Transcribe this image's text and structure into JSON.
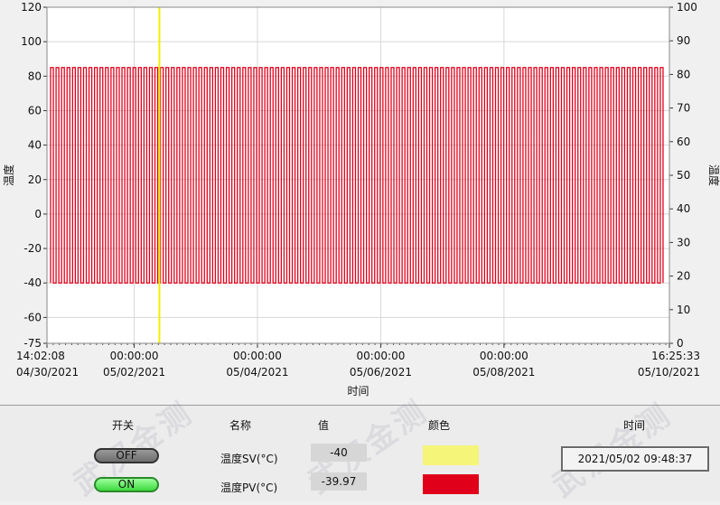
{
  "chart_data": {
    "type": "line",
    "ylabel_left": "温度",
    "ylabel_right": "温度",
    "xlabel": "时间",
    "ylim_left": [
      -75,
      120
    ],
    "yticks_left": [
      "120",
      "100",
      "80",
      "60",
      "40",
      "20",
      "0",
      "-20",
      "-40",
      "-60",
      "-75"
    ],
    "ylim_right": [
      0,
      100
    ],
    "yticks_right": [
      "100",
      "90",
      "80",
      "70",
      "60",
      "50",
      "40",
      "30",
      "20",
      "10",
      "0"
    ],
    "xticks": [
      {
        "time": "14:02:08",
        "date": "04/30/2021"
      },
      {
        "time": "00:00:00",
        "date": "05/02/2021"
      },
      {
        "time": "00:00:00",
        "date": "05/04/2021"
      },
      {
        "time": "00:00:00",
        "date": "05/06/2021"
      },
      {
        "time": "00:00:00",
        "date": "05/08/2021"
      },
      {
        "time": "16:25:33",
        "date": "05/10/2021"
      }
    ],
    "x_range": [
      "2021-04-30 14:02:08",
      "2021-05-10 16:25:33"
    ],
    "grid": true,
    "series": [
      {
        "name": "温度PV(°C)",
        "color": "#e0001a",
        "pattern": "oscillation",
        "min": -40,
        "max": 85,
        "cycles": 112
      },
      {
        "name": "温度SV(°C)",
        "color": "#f0f000",
        "pattern": "constant",
        "value": -40
      }
    ],
    "cursor_time": "2021-05-02 09:48:37"
  },
  "panel": {
    "headers": {
      "switch": "开关",
      "name": "名称",
      "value": "值",
      "color": "颜色",
      "time": "时间"
    },
    "rows": [
      {
        "switch": "OFF",
        "name": "温度SV(°C)",
        "value": "-40",
        "color": "#f5f57a"
      },
      {
        "switch": "ON",
        "name": "温度PV(°C)",
        "value": "-39.97",
        "color": "#e0001a"
      }
    ],
    "time_value": "2021/05/02 09:48:37"
  }
}
